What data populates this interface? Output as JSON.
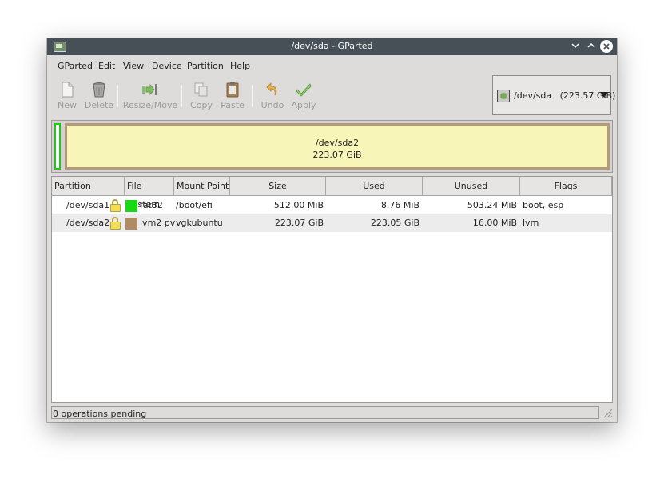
{
  "window": {
    "title": "/dev/sda - GParted"
  },
  "menubar": [
    {
      "pre": "",
      "u": "G",
      "post": "Parted"
    },
    {
      "pre": "",
      "u": "E",
      "post": "dit"
    },
    {
      "pre": "",
      "u": "V",
      "post": "iew"
    },
    {
      "pre": "",
      "u": "D",
      "post": "evice"
    },
    {
      "pre": "",
      "u": "P",
      "post": "artition"
    },
    {
      "pre": "",
      "u": "H",
      "post": "elp"
    }
  ],
  "toolbar": {
    "new": "New",
    "delete": "Delete",
    "resize_move": "Resize/Move",
    "copy": "Copy",
    "paste": "Paste",
    "undo": "Undo",
    "apply": "Apply"
  },
  "device_selector": {
    "device": "/dev/sda",
    "size": "(223.57 GiB)"
  },
  "disk_map": {
    "partition_name": "/dev/sda2",
    "partition_size": "223.07 GiB"
  },
  "table": {
    "headers": [
      "Partition",
      "File System",
      "Mount Point",
      "Size",
      "Used",
      "Unused",
      "Flags"
    ],
    "rows": [
      {
        "partition": "/dev/sda1",
        "fs": "fat32",
        "fs_color": "#18d818",
        "mount": "/boot/efi",
        "size": "512.00 MiB",
        "used": "8.76 MiB",
        "unused": "503.24 MiB",
        "flags": "boot, esp"
      },
      {
        "partition": "/dev/sda2",
        "fs": "lvm2 pv",
        "fs_color": "#b08b64",
        "mount": "vgkubuntu",
        "size": "223.07 GiB",
        "used": "223.05 GiB",
        "unused": "16.00 MiB",
        "flags": "lvm"
      }
    ]
  },
  "status": {
    "text": "0 operations pending"
  }
}
